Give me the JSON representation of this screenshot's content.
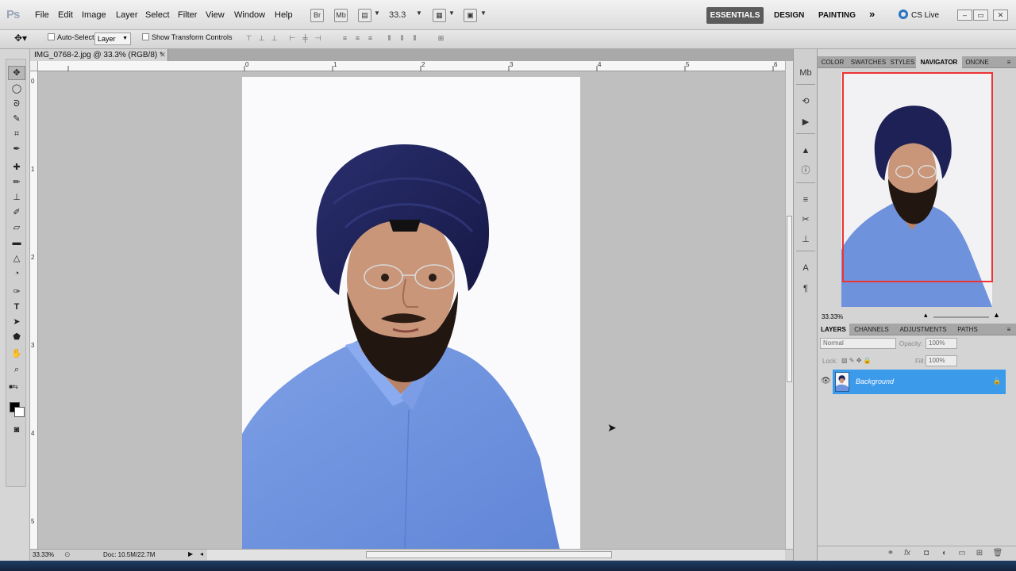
{
  "app": {
    "logo": "Ps"
  },
  "menu": [
    "File",
    "Edit",
    "Image",
    "Layer",
    "Select",
    "Filter",
    "View",
    "Window",
    "Help"
  ],
  "menubar_buttons": {
    "bridge": "Br",
    "minibridge": "Mb"
  },
  "zoom_field": "33.3",
  "workspaces": {
    "active": "ESSENTIALS",
    "others": [
      "DESIGN",
      "PAINTING"
    ],
    "more": "»"
  },
  "cs_live": "CS Live",
  "window_controls": [
    "–",
    "▭",
    "✕"
  ],
  "options": {
    "auto_select_label": "Auto-Select:",
    "auto_select_value": "Layer",
    "transform_label": "Show Transform Controls"
  },
  "document": {
    "tab_title": "IMG_0768-2.jpg @ 33.3% (RGB/8) *",
    "ruler_top": [
      "0",
      "1",
      "2",
      "3",
      "4",
      "5",
      "6"
    ],
    "ruler_left": [
      "0",
      "1",
      "2",
      "3",
      "4",
      "5"
    ],
    "status_zoom": "33.33%",
    "status_doc": "Doc: 10.5M/22.7M"
  },
  "panels": {
    "top_tabs": [
      "COLOR",
      "SWATCHES",
      "STYLES",
      "NAVIGATOR",
      "ONONE"
    ],
    "active_top": "NAVIGATOR",
    "nav_zoom": "33.33%",
    "layer_tabs": [
      "LAYERS",
      "CHANNELS",
      "ADJUSTMENTS",
      "PATHS"
    ],
    "active_layer_tab": "LAYERS",
    "blend_mode": "Normal",
    "opacity_label": "Opacity:",
    "opacity_value": "100%",
    "lock_label": "Lock:",
    "fill_label": "Fill:",
    "fill_value": "100%",
    "layers": [
      {
        "name": "Background",
        "visible": true,
        "locked": true
      }
    ]
  },
  "colors": {
    "foreground": "#000000",
    "background": "#ffffff",
    "turban": "#1d2155",
    "shirt": "#6f92dd",
    "selected_layer": "#3c9aeb"
  },
  "icons": {
    "tools": [
      "move-tool-icon",
      "marquee-tool-icon",
      "lasso-tool-icon",
      "quick-select-tool-icon",
      "crop-tool-icon",
      "eyedropper-tool-icon",
      "healing-brush-icon",
      "brush-tool-icon",
      "clone-stamp-icon",
      "history-brush-icon",
      "eraser-tool-icon",
      "gradient-tool-icon",
      "blur-tool-icon",
      "dodge-tool-icon",
      "pen-tool-icon",
      "type-tool-icon",
      "path-select-icon",
      "shape-tool-icon",
      "3d-rotate-icon",
      "hand-tool-icon",
      "zoom-tool-icon"
    ]
  }
}
